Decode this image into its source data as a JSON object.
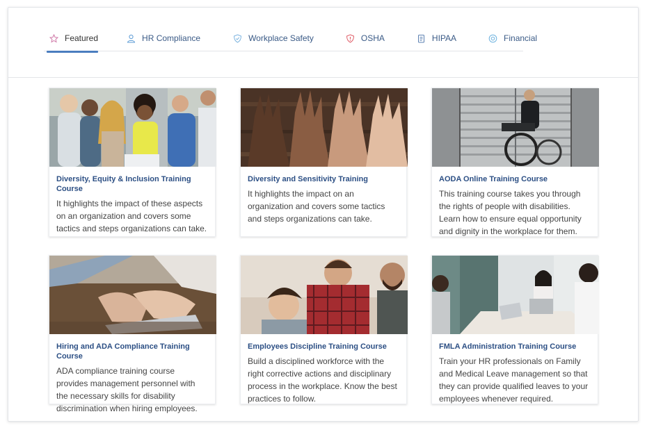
{
  "tabs": [
    {
      "label": "Featured",
      "icon": "star-icon",
      "active": true
    },
    {
      "label": "HR Compliance",
      "icon": "user-icon"
    },
    {
      "label": "Workplace Safety",
      "icon": "shield-icon"
    },
    {
      "label": "OSHA",
      "icon": "shield-alert-icon"
    },
    {
      "label": "HIPAA",
      "icon": "clipboard-icon"
    },
    {
      "label": "Financial",
      "icon": "coin-icon"
    }
  ],
  "courses": [
    {
      "title": "Diversity, Equity & Inclusion Training Course",
      "description": "It highlights the impact of these aspects on an organization and covers some tactics and steps organizations can take."
    },
    {
      "title": "Diversity and Sensitivity Training",
      "description": "It highlights the impact on an organization and covers some tactics and steps organizations can take."
    },
    {
      "title": "AODA Online Training Course",
      "description": "This training course takes you through the rights of people with disabilities. Learn how to ensure equal opportunity and dignity in the workplace for them."
    },
    {
      "title": "Hiring and ADA Compliance Training Course",
      "description": "ADA compliance training course provides management personnel with the necessary skills for disability discrimination when hiring employees."
    },
    {
      "title": "Employees Discipline Training Course",
      "description": "Build a disciplined workforce with the right corrective actions and disciplinary process in the workplace. Know the best practices to follow."
    },
    {
      "title": "FMLA Administration Training Course",
      "description": "Train your HR professionals on Family and Medical Leave management so that they can provide qualified leaves to your employees whenever required."
    }
  ],
  "colors": {
    "accent": "#4a7dbf",
    "title": "#2c4f84",
    "tab_text": "#3a5a86"
  }
}
